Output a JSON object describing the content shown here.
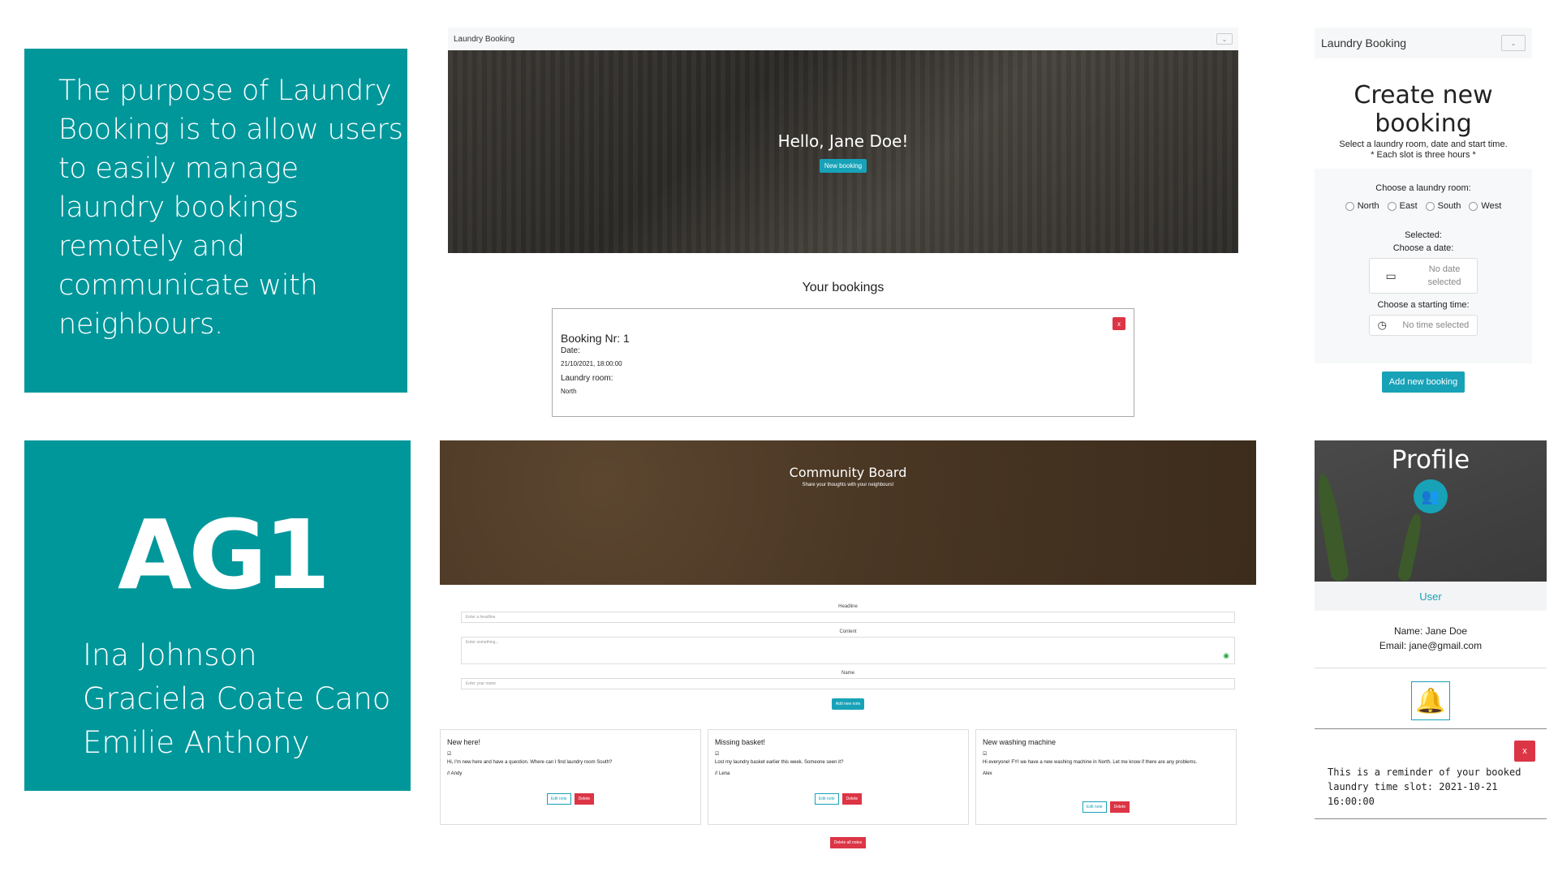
{
  "purpose": {
    "text": "The purpose of Laundry Booking is to allow users to easily manage laundry bookings remotely and communicate with neighbours."
  },
  "team": {
    "code": "AG1",
    "members": [
      "Ina Johnson",
      "Graciela Coate Cano",
      "Emilie Anthony"
    ]
  },
  "home": {
    "brand": "Laundry Booking",
    "greeting": "Hello, Jane Doe!",
    "new_booking_btn": "New booking",
    "bookings_title": "Your bookings",
    "booking": {
      "title": "Booking Nr: 1",
      "date_label": "Date:",
      "date_value": "21/10/2021, 18:00:00",
      "room_label": "Laundry room:",
      "room_value": "North",
      "close": "x"
    }
  },
  "create": {
    "brand": "Laundry Booking",
    "title_line1": "Create new",
    "title_line2": "booking",
    "subtitle": "Select a laundry room, date and start time.",
    "subtitle2": "* Each slot is three hours *",
    "room_label": "Choose a laundry room:",
    "rooms": [
      "North",
      "East",
      "South",
      "West"
    ],
    "selected_label": "Selected:",
    "date_label": "Choose a date:",
    "date_placeholder_1": "No date",
    "date_placeholder_2": "selected",
    "time_label": "Choose a starting time:",
    "time_placeholder": "No time selected",
    "submit": "Add new booking"
  },
  "community": {
    "title": "Community Board",
    "subtitle": "Share your thoughts with your neighbours!",
    "headline_label": "Headline",
    "headline_placeholder": "Enter a headline",
    "content_label": "Content",
    "content_placeholder": "Enter something...",
    "name_label": "Name",
    "name_placeholder": "Enter your name",
    "add_btn": "Add new note",
    "delete_all": "Delete all notes",
    "notes": [
      {
        "title": "New here!",
        "body": "Hi, I'm new here and have a question. Where can I find laundry room South?",
        "author": "// Andy",
        "edit": "Edit note",
        "delete": "Delete"
      },
      {
        "title": "Missing basket!",
        "body": "Lost my laundry basket earlier this week. Someone seen it?",
        "author": "// Lena",
        "edit": "Edit note",
        "delete": "Delete"
      },
      {
        "title": "New washing machine",
        "body": "Hi everyone! FYI we have a new washing machine in North. Let me know if there are any problems.",
        "author": "Alex",
        "edit": "Edit note",
        "delete": "Delete"
      }
    ]
  },
  "profile": {
    "title": "Profile",
    "tab": "User",
    "name": "Name: Jane Doe",
    "email": "Email: jane@gmail.com",
    "reminder_line1": "This is a reminder of your booked",
    "reminder_line2": "laundry time slot: 2021-10-21 16:00:00",
    "close": "x"
  },
  "colors": {
    "teal": "#00979b",
    "accent": "#17a2b8",
    "danger": "#dc3545"
  }
}
